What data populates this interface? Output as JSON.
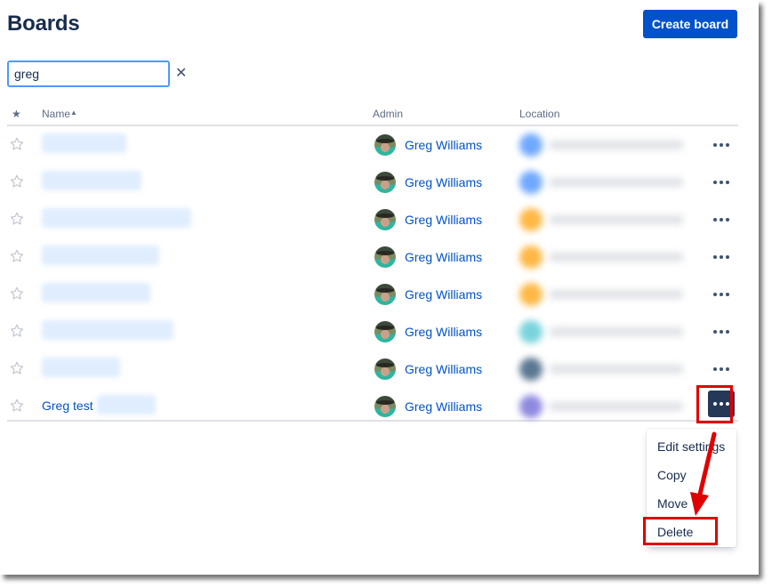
{
  "header": {
    "title": "Boards",
    "create_button": "Create board"
  },
  "search": {
    "value": "greg",
    "placeholder": "",
    "clear_icon": "close-icon"
  },
  "table": {
    "columns": {
      "star": "starred-column-icon",
      "name": "Name",
      "name_sort": "ascending",
      "admin": "Admin",
      "location": "Location"
    },
    "rows": [
      {
        "name": "",
        "name_blurred": true,
        "admin": "Greg Williams",
        "location_color": "#6fa8ff",
        "starred": false
      },
      {
        "name": "",
        "name_blurred": true,
        "admin": "Greg Williams",
        "location_color": "#6fa8ff",
        "starred": false
      },
      {
        "name": "",
        "name_blurred": true,
        "admin": "Greg Williams",
        "location_color": "#ffb845",
        "starred": false
      },
      {
        "name": "",
        "name_blurred": true,
        "admin": "Greg Williams",
        "location_color": "#ffb845",
        "starred": false
      },
      {
        "name": "",
        "name_blurred": true,
        "admin": "Greg Williams",
        "location_color": "#ffb845",
        "starred": false
      },
      {
        "name": "",
        "name_blurred": true,
        "admin": "Greg Williams",
        "location_color": "#79d3dc",
        "starred": false
      },
      {
        "name": "",
        "name_blurred": true,
        "admin": "Greg Williams",
        "location_color": "#5b7892",
        "starred": false
      },
      {
        "name": "Greg test",
        "name_blurred": false,
        "admin": "Greg Williams",
        "location_color": "#8f89e0",
        "starred": false,
        "menu_open": true
      }
    ]
  },
  "row_menu": {
    "items": [
      {
        "label": "Edit settings"
      },
      {
        "label": "Copy"
      },
      {
        "label": "Move"
      },
      {
        "label": "Delete",
        "highlighted": true
      }
    ]
  },
  "annotations": {
    "highlight_color": "#e00000",
    "arrow_target": "Delete"
  }
}
